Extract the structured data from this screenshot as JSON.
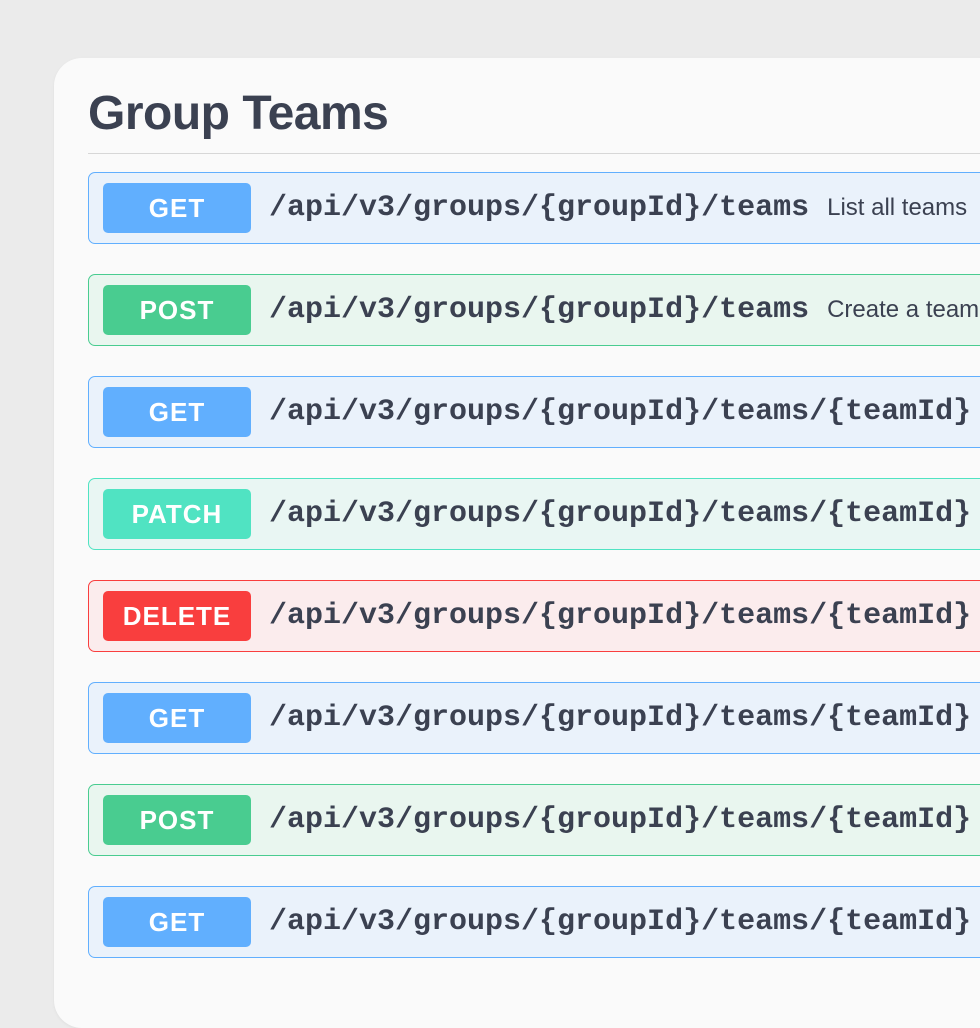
{
  "section": {
    "title": "Group Teams"
  },
  "colors": {
    "get": {
      "badge": "#61affe",
      "bg": "#eaf2fb",
      "border": "#61affe"
    },
    "post": {
      "badge": "#49cc90",
      "bg": "#e9f6ef",
      "border": "#49cc90"
    },
    "patch": {
      "badge": "#50e3c2",
      "bg": "#e9f6f3",
      "border": "#50e3c2"
    },
    "delete": {
      "badge": "#f93e3e",
      "bg": "#fbeced",
      "border": "#f93e3e"
    }
  },
  "operations": [
    {
      "method": "GET",
      "method_class": "get",
      "path": "/api/v3/groups/{groupId}/teams",
      "summary": "List all teams"
    },
    {
      "method": "POST",
      "method_class": "post",
      "path": "/api/v3/groups/{groupId}/teams",
      "summary": "Create a team"
    },
    {
      "method": "GET",
      "method_class": "get",
      "path": "/api/v3/groups/{groupId}/teams/{teamId}",
      "summary": ""
    },
    {
      "method": "PATCH",
      "method_class": "patch",
      "path": "/api/v3/groups/{groupId}/teams/{teamId}",
      "summary": ""
    },
    {
      "method": "DELETE",
      "method_class": "delete",
      "path": "/api/v3/groups/{groupId}/teams/{teamId}",
      "summary": ""
    },
    {
      "method": "GET",
      "method_class": "get",
      "path": "/api/v3/groups/{groupId}/teams/{teamId}",
      "summary": ""
    },
    {
      "method": "POST",
      "method_class": "post",
      "path": "/api/v3/groups/{groupId}/teams/{teamId}",
      "summary": ""
    },
    {
      "method": "GET",
      "method_class": "get",
      "path": "/api/v3/groups/{groupId}/teams/{teamId}",
      "summary": ""
    }
  ]
}
